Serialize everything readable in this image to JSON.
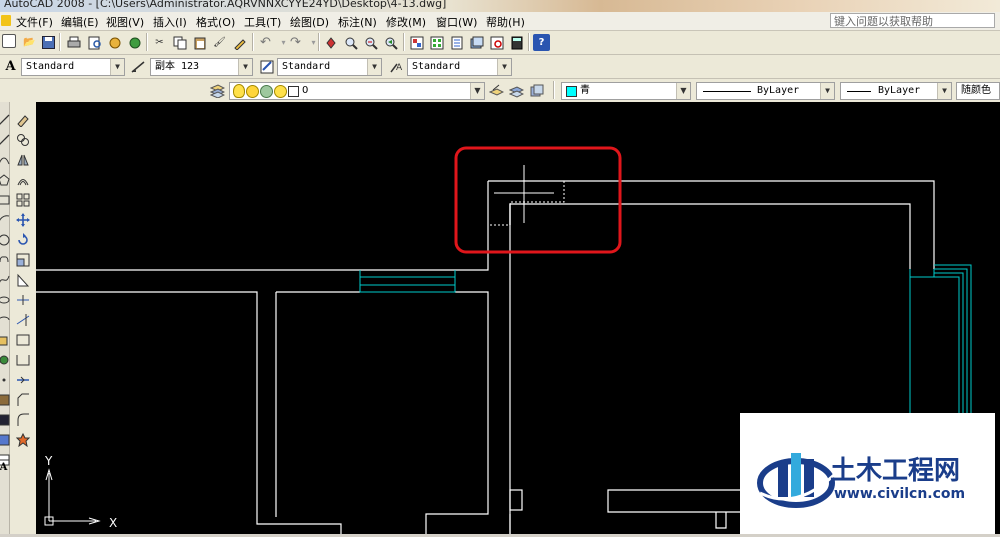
{
  "app": {
    "title": "AutoCAD 2008 - [C:\\Users\\Administrator.AQRVNNXCYYE24YD\\Desktop\\4-13.dwg]"
  },
  "menu": {
    "items": [
      "文件(F)",
      "编辑(E)",
      "视图(V)",
      "插入(I)",
      "格式(O)",
      "工具(T)",
      "绘图(D)",
      "标注(N)",
      "修改(M)",
      "窗口(W)",
      "帮助(H)"
    ],
    "help_search": "键入问题以获取帮助"
  },
  "styles_toolbar": {
    "text_style": "Standard",
    "dim_style": "副本 123",
    "table_style": "Standard",
    "mleader_style": "Standard"
  },
  "layers_toolbar": {
    "layer": "0",
    "color": "青",
    "linetype": "ByLayer",
    "lineweight": "ByLayer",
    "plotstyle": "随颜色"
  },
  "ucs": {
    "x_label": "X",
    "y_label": "Y"
  },
  "watermark": {
    "title": "土木工程网",
    "url": "www.civilcn.com"
  },
  "colors": {
    "drawing_bg": "#000000",
    "wall_line": "#ffffff",
    "window_line": "#00cccc",
    "highlight_box": "#e0161b",
    "watermark_text": "#1a3d8a",
    "watermark_accent": "#33aadd"
  }
}
